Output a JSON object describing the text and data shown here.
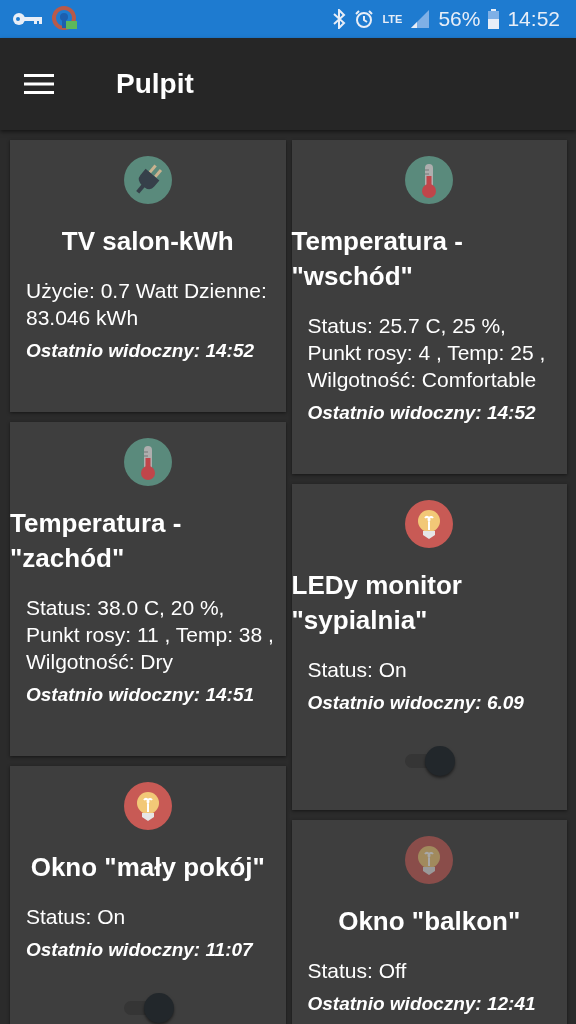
{
  "status_bar": {
    "network": "LTE",
    "battery": "56%",
    "time": "14:52"
  },
  "app_bar": {
    "title": "Pulpit"
  },
  "columns": [
    {
      "cards": [
        {
          "icon": {
            "kind": "plug",
            "on": true
          },
          "title": "TV salon-kWh",
          "details": "Użycie: 0.7 Watt Dzienne: 83.046 kWh",
          "last_seen": "Ostatnio widoczny: 14:52"
        },
        {
          "icon": {
            "kind": "thermometer",
            "on": true
          },
          "title": "Temperatura - \"zachód\"",
          "details": "Status: 38.0 C, 20 %, Punkt rosy: 11 , Temp: 38 , Wilgotność: Dry",
          "last_seen": "Ostatnio widoczny: 14:51"
        },
        {
          "icon": {
            "kind": "bulb",
            "on": true
          },
          "title": "Okno \"mały pokój\"",
          "details": "Status: On",
          "last_seen": "Ostatnio widoczny: 11:07",
          "switch": {
            "on": true
          }
        }
      ]
    },
    {
      "cards": [
        {
          "icon": {
            "kind": "thermometer",
            "on": true
          },
          "title": "Temperatura - \"wschód\"",
          "details": "Status: 25.7 C, 25 %, Punkt rosy: 4 , Temp: 25 , Wilgotność: Comfortable",
          "last_seen": "Ostatnio widoczny: 14:52"
        },
        {
          "icon": {
            "kind": "bulb",
            "on": true
          },
          "title": "LEDy monitor \"sypialnia\"",
          "details": "Status: On",
          "last_seen": "Ostatnio widoczny: 6.09",
          "switch": {
            "on": true
          }
        },
        {
          "icon": {
            "kind": "bulb",
            "on": false
          },
          "title": "Okno \"balkon\"",
          "details": "Status: Off",
          "last_seen": "Ostatnio widoczny: 12:41"
        }
      ]
    }
  ]
}
